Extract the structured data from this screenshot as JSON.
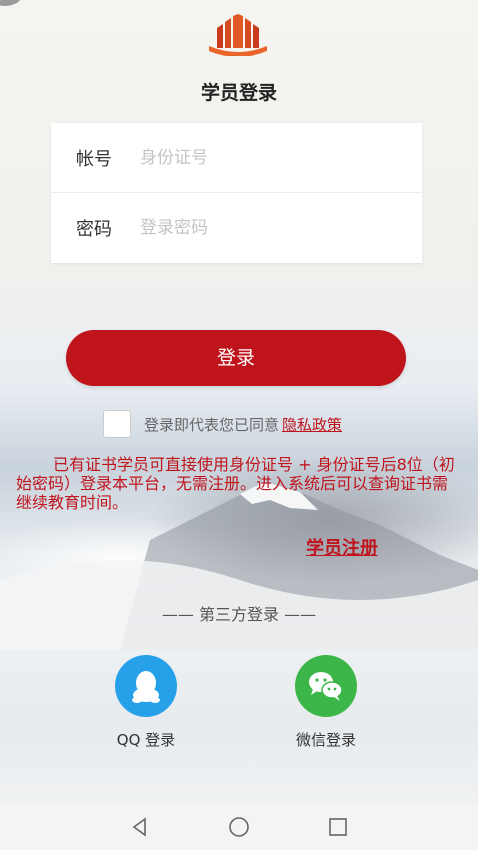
{
  "title": "学员登录",
  "form": {
    "account_label": "帐号",
    "account_placeholder": "身份证号",
    "password_label": "密码",
    "password_placeholder": "登录密码"
  },
  "login_button": "登录",
  "agreement": {
    "text": "登录即代表您已同意",
    "link": "隐私政策"
  },
  "notice": "已有证书学员可直接使用身份证号 + 身份证号后8位（初始密码）登录本平台，无需注册。进入系统后可以查询证书需继续教育时间。",
  "register_link": "学员注册",
  "third_party": {
    "title": "—— 第三方登录 ——",
    "qq_label": "QQ 登录",
    "wechat_label": "微信登录"
  },
  "colors": {
    "accent": "#c0141d",
    "qq": "#27a0ea",
    "wechat": "#3cb648"
  },
  "icons": [
    "back-nav-icon",
    "home-nav-icon",
    "recents-nav-icon",
    "qq-icon",
    "wechat-icon",
    "logo-icon"
  ]
}
